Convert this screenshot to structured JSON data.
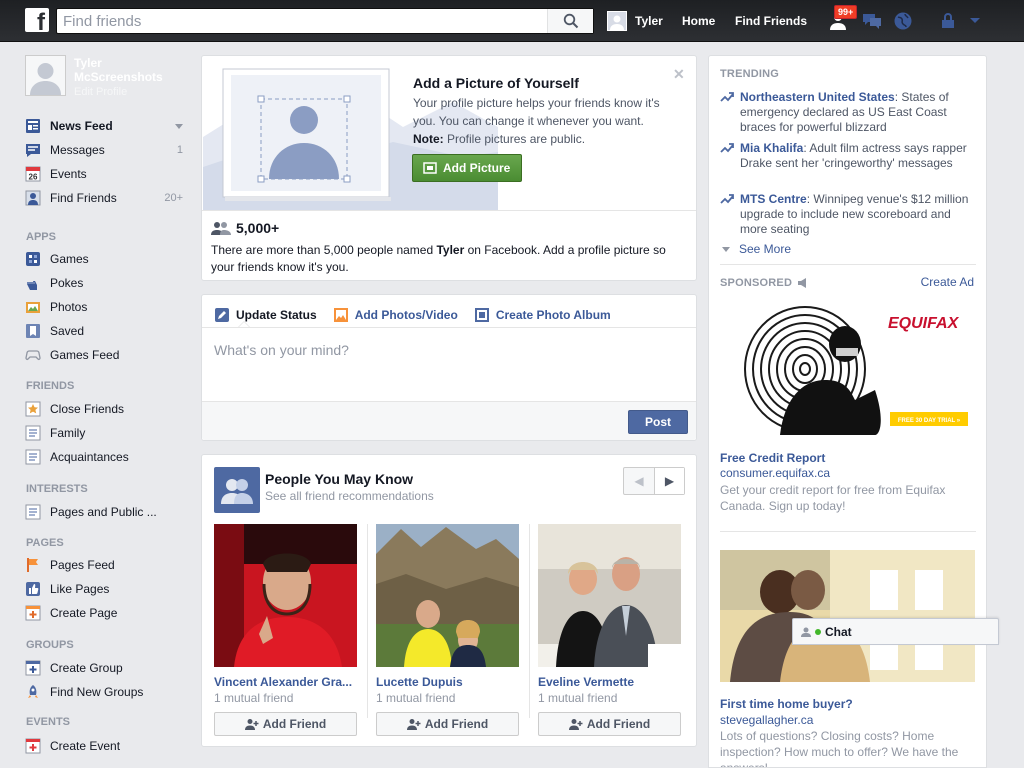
{
  "topbar": {
    "logo": "f",
    "search_placeholder": "Find friends",
    "user_name": "Tyler",
    "home": "Home",
    "find_friends": "Find Friends",
    "notif_count": "99+",
    "icons": [
      "friend-requests-icon",
      "messages-icon",
      "notifications-globe-icon",
      "privacy-lock-icon",
      "account-menu-icon"
    ]
  },
  "left": {
    "profile_name": "Tyler McScreenshots",
    "edit_profile": "Edit Profile",
    "main": [
      {
        "label": "News Feed",
        "count": "",
        "icon": "news-feed-icon"
      },
      {
        "label": "Messages",
        "count": "1",
        "icon": "messages-icon"
      },
      {
        "label": "Events",
        "count": "",
        "icon": "events-calendar-icon"
      },
      {
        "label": "Find Friends",
        "count": "20+",
        "icon": "find-friends-icon"
      }
    ],
    "apps_head": "APPS",
    "apps": [
      "Games",
      "Pokes",
      "Photos",
      "Saved",
      "Games Feed"
    ],
    "friends_head": "FRIENDS",
    "friends": [
      "Close Friends",
      "Family",
      "Acquaintances"
    ],
    "interests_head": "INTERESTS",
    "interests": [
      "Pages and Public ..."
    ],
    "pages_head": "PAGES",
    "pages": [
      "Pages Feed",
      "Like Pages",
      "Create Page"
    ],
    "groups_head": "GROUPS",
    "groups": [
      "Create Group",
      "Find New Groups"
    ],
    "events_head": "EVENTS",
    "events": [
      "Create Event"
    ]
  },
  "addpic": {
    "title": "Add a Picture of Yourself",
    "body": "Your profile picture helps your friends know it's you. You can change it whenever you want.",
    "note_label": "Note:",
    "note_text": " Profile pictures are public.",
    "button": "Add Picture",
    "count": "5,000+",
    "desc_pre": "There are more than 5,000 people named ",
    "desc_name": "Tyler",
    "desc_post": " on Facebook. Add a profile picture so your friends know it's you."
  },
  "composer": {
    "tabs": [
      "Update Status",
      "Add Photos/Video",
      "Create Photo Album"
    ],
    "placeholder": "What's on your mind?",
    "post": "Post"
  },
  "pymk": {
    "title": "People You May Know",
    "subtitle": "See all friend recommendations",
    "add_label": "Add Friend",
    "people": [
      {
        "name": "Vincent Alexander Gra...",
        "mutual": "1 mutual friend"
      },
      {
        "name": "Lucette Dupuis",
        "mutual": "1 mutual friend"
      },
      {
        "name": "Eveline Vermette",
        "mutual": "1 mutual friend"
      }
    ]
  },
  "trending": {
    "head": "TRENDING",
    "items": [
      {
        "topic": "Northeastern United States",
        "text": ": States of emergency declared as US East Coast braces for powerful blizzard"
      },
      {
        "topic": "Mia Khalifa",
        "text": ": Adult film actress says rapper Drake sent her 'cringeworthy' messages"
      },
      {
        "topic": "MTS Centre",
        "text": ": Winnipeg venue's $12 million upgrade to include new scoreboard and more seating"
      }
    ],
    "see_more": "See More"
  },
  "sponsored": {
    "head": "SPONSORED",
    "create_ad": "Create Ad",
    "ads": [
      {
        "brand": "EQUIFAX",
        "badge": "FREE 30 DAY TRIAL »",
        "title": "Free Credit Report",
        "url": "consumer.equifax.ca",
        "desc": "Get your credit report for free from Equifax Canada. Sign up today!"
      },
      {
        "title": "First time home buyer?",
        "url": "stevegallagher.ca",
        "desc": "Lots of questions? Closing costs? Home inspection? How much to offer? We have the answers!"
      }
    ]
  },
  "chat": {
    "label": "Chat"
  },
  "colors": {
    "brand": "#3b5998",
    "topbar": "#2d2f33",
    "green": "#4a8c32",
    "badge": "#f03d25"
  }
}
